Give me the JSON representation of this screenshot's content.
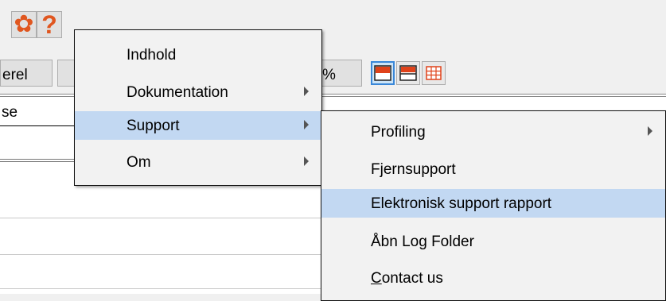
{
  "toolbar": {
    "settings_icon": "gear-icon",
    "help_icon": "help-icon",
    "help_glyph": "?",
    "gear_glyph": "✿",
    "erel_label": "erel",
    "percent_label": "%",
    "layout_buttons": [
      "layout-single",
      "layout-split",
      "layout-grid"
    ]
  },
  "grid": {
    "header_label": "se"
  },
  "help_menu": {
    "items": [
      {
        "label": "Indhold",
        "submenu": false,
        "highlighted": false
      },
      {
        "label": "Dokumentation",
        "submenu": true,
        "highlighted": false
      },
      {
        "label": "Support",
        "submenu": true,
        "highlighted": true
      },
      {
        "label": "Om",
        "submenu": true,
        "highlighted": false
      }
    ]
  },
  "support_menu": {
    "items": [
      {
        "label": "Profiling",
        "submenu": true,
        "highlighted": false
      },
      {
        "label": "Fjernsupport",
        "submenu": false,
        "highlighted": false
      },
      {
        "label": "Elektronisk support rapport",
        "submenu": false,
        "highlighted": true
      },
      {
        "label": "Åbn Log Folder",
        "submenu": false,
        "highlighted": false
      },
      {
        "label_underlined": "C",
        "label_rest": "ontact us",
        "submenu": false,
        "highlighted": false
      }
    ]
  },
  "colors": {
    "accent": "#e0561f",
    "highlight": "#c2d8f2",
    "active_border": "#3a87d8"
  }
}
